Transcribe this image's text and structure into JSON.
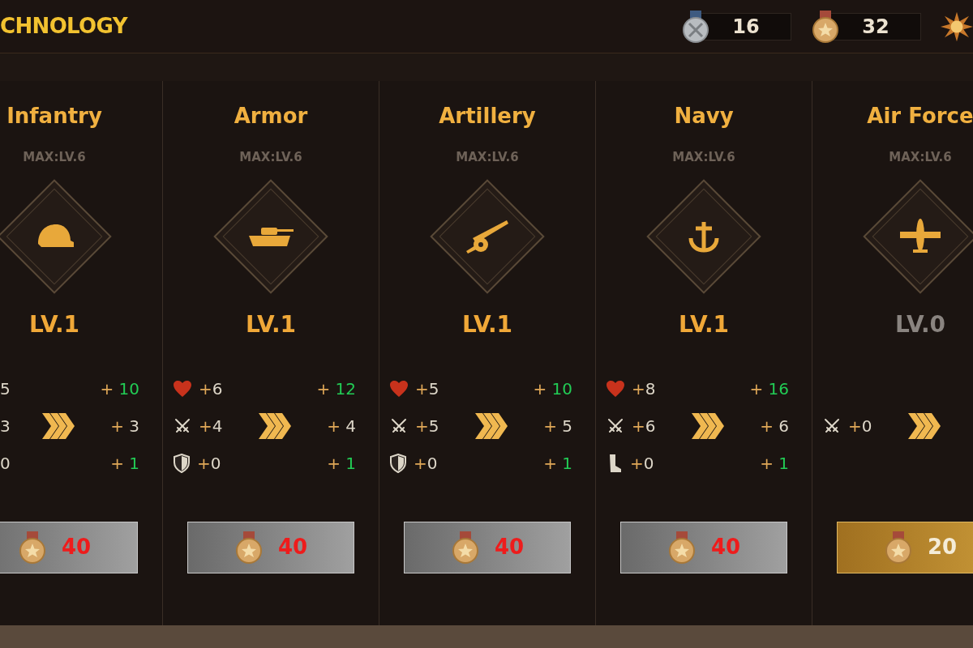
{
  "header": {
    "title": "CHNOLOGY",
    "currencies": [
      {
        "kind": "silver",
        "amount": "16"
      },
      {
        "kind": "bronze",
        "amount": "32"
      }
    ]
  },
  "branches": [
    {
      "name": "Infantry",
      "max": "MAX:LV.6",
      "level": "LV.1",
      "unlocked": true,
      "stats": [
        {
          "current": "5",
          "bonus_sign": "+",
          "bonus": "10",
          "increased": true
        },
        {
          "current": "3",
          "bonus_sign": "+",
          "bonus": "3",
          "increased": false
        },
        {
          "current": "0",
          "bonus_sign": "+",
          "bonus": "1",
          "increased": true
        }
      ],
      "cost": "40",
      "affordable": false
    },
    {
      "name": "Armor",
      "max": "MAX:LV.6",
      "level": "LV.1",
      "unlocked": true,
      "stats": [
        {
          "kind": "heart",
          "current_sign": "+",
          "current": "6",
          "bonus_sign": "+",
          "bonus": "12",
          "increased": true
        },
        {
          "kind": "swords",
          "current_sign": "+",
          "current": "4",
          "bonus_sign": "+",
          "bonus": "4",
          "increased": false
        },
        {
          "kind": "shield",
          "current_sign": "+",
          "current": "0",
          "bonus_sign": "+",
          "bonus": "1",
          "increased": true
        }
      ],
      "cost": "40",
      "affordable": false
    },
    {
      "name": "Artillery",
      "max": "MAX:LV.6",
      "level": "LV.1",
      "unlocked": true,
      "stats": [
        {
          "kind": "heart",
          "current_sign": "+",
          "current": "5",
          "bonus_sign": "+",
          "bonus": "10",
          "increased": true
        },
        {
          "kind": "swords",
          "current_sign": "+",
          "current": "5",
          "bonus_sign": "+",
          "bonus": "5",
          "increased": false
        },
        {
          "kind": "shield",
          "current_sign": "+",
          "current": "0",
          "bonus_sign": "+",
          "bonus": "1",
          "increased": true
        }
      ],
      "cost": "40",
      "affordable": false
    },
    {
      "name": "Navy",
      "max": "MAX:LV.6",
      "level": "LV.1",
      "unlocked": true,
      "stats": [
        {
          "kind": "heart",
          "current_sign": "+",
          "current": "8",
          "bonus_sign": "+",
          "bonus": "16",
          "increased": true
        },
        {
          "kind": "swords",
          "current_sign": "+",
          "current": "6",
          "bonus_sign": "+",
          "bonus": "6",
          "increased": false
        },
        {
          "kind": "boot",
          "current_sign": "+",
          "current": "0",
          "bonus_sign": "+",
          "bonus": "1",
          "increased": true
        }
      ],
      "cost": "40",
      "affordable": false
    },
    {
      "name": "Air Force",
      "max": "MAX:LV.6",
      "level": "LV.0",
      "unlocked": false,
      "stats": [
        {
          "kind": "swords",
          "current_sign": "+",
          "current": "0"
        }
      ],
      "cost": "20",
      "affordable": true
    }
  ]
}
